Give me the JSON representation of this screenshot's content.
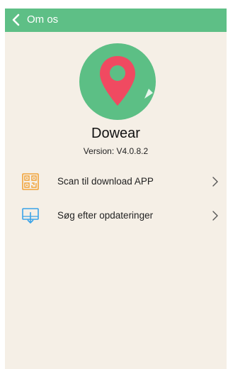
{
  "header": {
    "title": "Om os",
    "back_icon": "chevron-left-icon"
  },
  "app": {
    "logo_icon": "location-pin-icon",
    "name": "Dowear",
    "version": "Version: V4.0.8.2"
  },
  "menu": {
    "items": [
      {
        "label": "Scan til download APP",
        "icon": "qr-code-icon",
        "chevron": "chevron-right-icon"
      },
      {
        "label": "Søg efter opdateringer",
        "icon": "download-update-icon",
        "chevron": "chevron-right-icon"
      }
    ]
  },
  "colors": {
    "header": "#5ebf86",
    "background": "#f5efe6",
    "logo_circle": "#5cbf85",
    "pin": "#f04a61",
    "qr_icon": "#f2a33a",
    "update_icon": "#3aa3e8"
  }
}
